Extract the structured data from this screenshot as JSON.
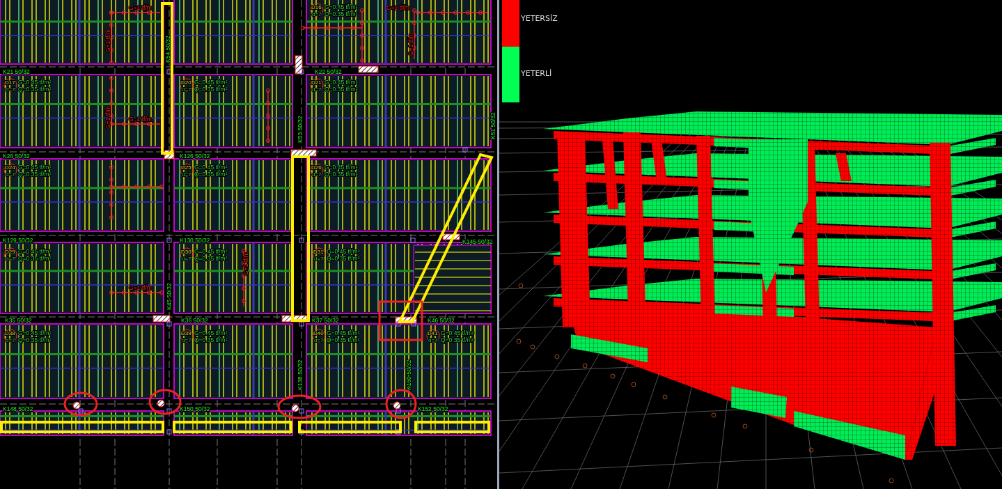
{
  "plan": {
    "slabs": [
      {
        "name": "D16",
        "thickness": "d=7",
        "dead_load": "G=0.45 tf/m²",
        "live_load": "Q=0.35 tf/m²"
      },
      {
        "name": "D17",
        "thickness": "d=7",
        "dead_load": "G=0.45 tf/m²",
        "live_load": "Q=0.35 tf/m²"
      },
      {
        "name": "D20",
        "thickness": "d=7",
        "dead_load": "G=0.45 tf/m²",
        "live_load": "Q=0.35 tf/m²"
      },
      {
        "name": "D21",
        "thickness": "d=7",
        "dead_load": "G=0.45 tf/m²",
        "live_load": "Q=0.35 tf/m²"
      },
      {
        "name": "D24",
        "thickness": "d=7",
        "dead_load": "G=0.45 tf/m²",
        "live_load": "Q=0.35 tf/m²"
      },
      {
        "name": "D25",
        "thickness": "d=7",
        "dead_load": "G=0.45 tf/m²",
        "live_load": "Q=0.35 tf/m²"
      },
      {
        "name": "D26",
        "thickness": "d=7",
        "dead_load": "G=0.45 tf/m²",
        "live_load": "Q=0.35 tf/m²"
      },
      {
        "name": "D29",
        "thickness": "d=7",
        "dead_load": "G=0.45 tf/m²",
        "live_load": "Q=0.35 tf/m²"
      },
      {
        "name": "D30",
        "thickness": "d=7",
        "dead_load": "G=0.45 tf/m²",
        "live_load": "Q=0.35 tf/m²"
      },
      {
        "name": "D31",
        "thickness": "d=7",
        "dead_load": "G=0.45 tf/m²",
        "live_load": "Q=0.35 tf/m²"
      },
      {
        "name": "D38",
        "thickness": "d=7",
        "dead_load": "G=0.45 tf/m²",
        "live_load": "Q=0.35 tf/m²"
      },
      {
        "name": "D39",
        "thickness": "d=7",
        "dead_load": "G=0.45 tf/m²",
        "live_load": "Q=0.35 tf/m²"
      },
      {
        "name": "D40",
        "thickness": "d=7",
        "dead_load": "G=0.45 tf/m²",
        "live_load": "Q=0.35 tf/m²"
      },
      {
        "name": "D41",
        "thickness": "d=7",
        "dead_load": "G=0.45 tf/m²",
        "live_load": "Q=0.35 tf/m²"
      }
    ],
    "beams": [
      {
        "label": "K21 50/32",
        "kind": "horizontal"
      },
      {
        "label": "K22 50/32",
        "kind": "horizontal"
      },
      {
        "label": "K26 50/32",
        "kind": "horizontal"
      },
      {
        "label": "K126 50/32",
        "kind": "horizontal"
      },
      {
        "label": "K129 50/32",
        "kind": "horizontal"
      },
      {
        "label": "K130 50/32",
        "kind": "horizontal"
      },
      {
        "label": "K145 50/32",
        "kind": "horizontal"
      },
      {
        "label": "K35 50/32",
        "kind": "horizontal"
      },
      {
        "label": "K36 50/32",
        "kind": "horizontal"
      },
      {
        "label": "K37 50/32",
        "kind": "horizontal"
      },
      {
        "label": "K46 50/32",
        "kind": "horizontal"
      },
      {
        "label": "K148 50/32",
        "kind": "horizontal"
      },
      {
        "label": "K150 50/32",
        "kind": "horizontal"
      },
      {
        "label": "K152 50/32",
        "kind": "horizontal"
      },
      {
        "label": "K54 50/32",
        "kind": "vertical"
      },
      {
        "label": "K53 50/32",
        "kind": "vertical"
      },
      {
        "label": "K51 50/32",
        "kind": "vertical"
      },
      {
        "label": "K45 50/32",
        "kind": "vertical"
      },
      {
        "label": "K138 50/32",
        "kind": "vertical"
      },
      {
        "label": "K160 50/32",
        "kind": "vertical"
      }
    ],
    "loads": [
      {
        "label": "G=1 tf/m",
        "kind": "horizontal"
      },
      {
        "label": "G=1 tf/m",
        "kind": "horizontal"
      },
      {
        "label": "G=1 tf/m",
        "kind": "vertical"
      },
      {
        "label": "G=1 tf/m",
        "kind": "vertical"
      },
      {
        "label": "G=1 tf/m",
        "kind": "horizontal"
      },
      {
        "label": "G=1 tf/m",
        "kind": "vertical"
      },
      {
        "label": "G=1 tf/m",
        "kind": "vertical"
      },
      {
        "label": "G=1 tf/m",
        "kind": "horizontal"
      }
    ]
  },
  "model": {
    "legend": [
      {
        "label": "YETERSİZ",
        "color": "#ff0000"
      },
      {
        "label": "YETERLİ",
        "color": "#00ff55"
      }
    ]
  }
}
